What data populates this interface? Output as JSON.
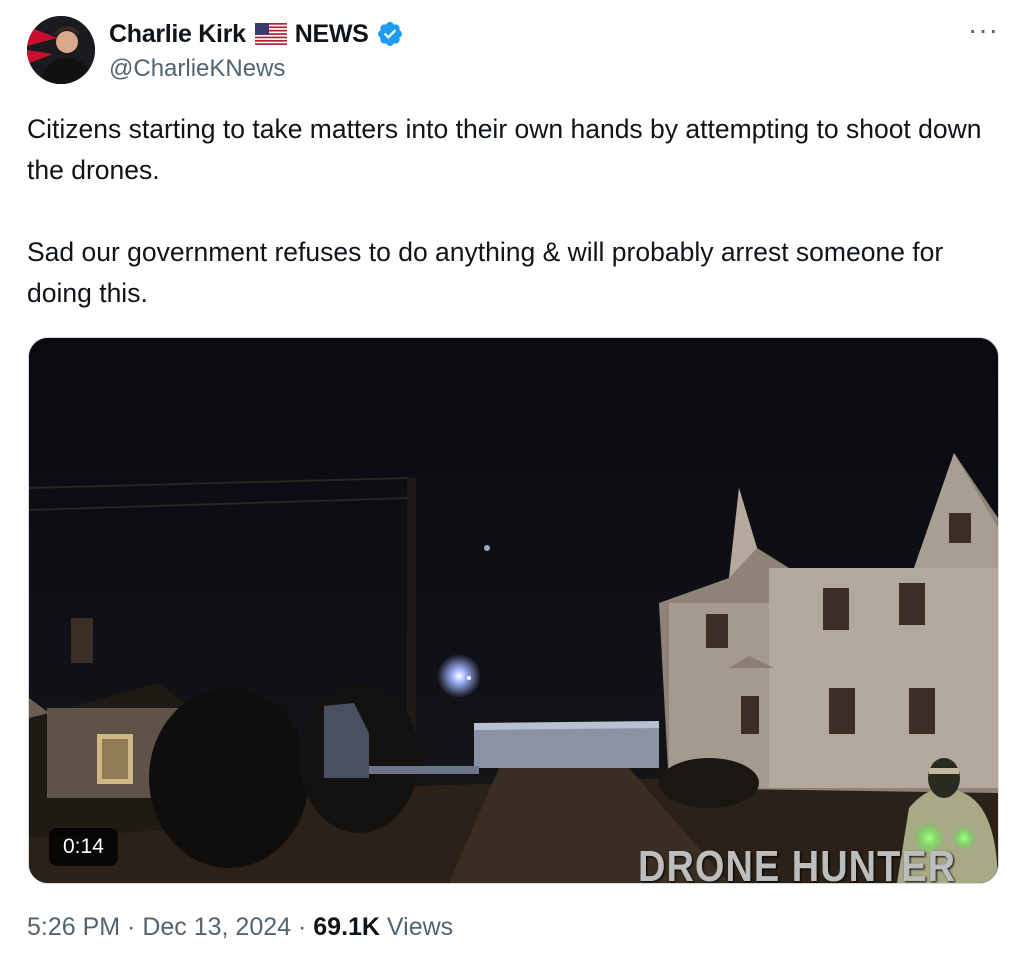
{
  "author": {
    "name": "Charlie Kirk",
    "flag_icon": "us-flag-icon",
    "suffix": "NEWS",
    "verified_icon": "verified-badge-icon",
    "handle": "@CharlieKNews"
  },
  "more_icon": "more-options-icon",
  "more_label": "···",
  "tweet": {
    "paragraphs": [
      "Citizens starting to take matters into their own hands by attempting to shoot down the drones.",
      "Sad our government refuses to do anything & will probably arrest someone for doing this."
    ]
  },
  "video": {
    "duration": "0:14",
    "watermark": "DRONE HUNTER"
  },
  "meta": {
    "time": "5:26 PM",
    "separator": " · ",
    "date": "Dec 13, 2024",
    "views_count": "69.1K",
    "views_label": " Views"
  },
  "colors": {
    "verified_blue": "#1d9bf0",
    "text_primary": "#0f1419",
    "text_secondary": "#536471"
  }
}
